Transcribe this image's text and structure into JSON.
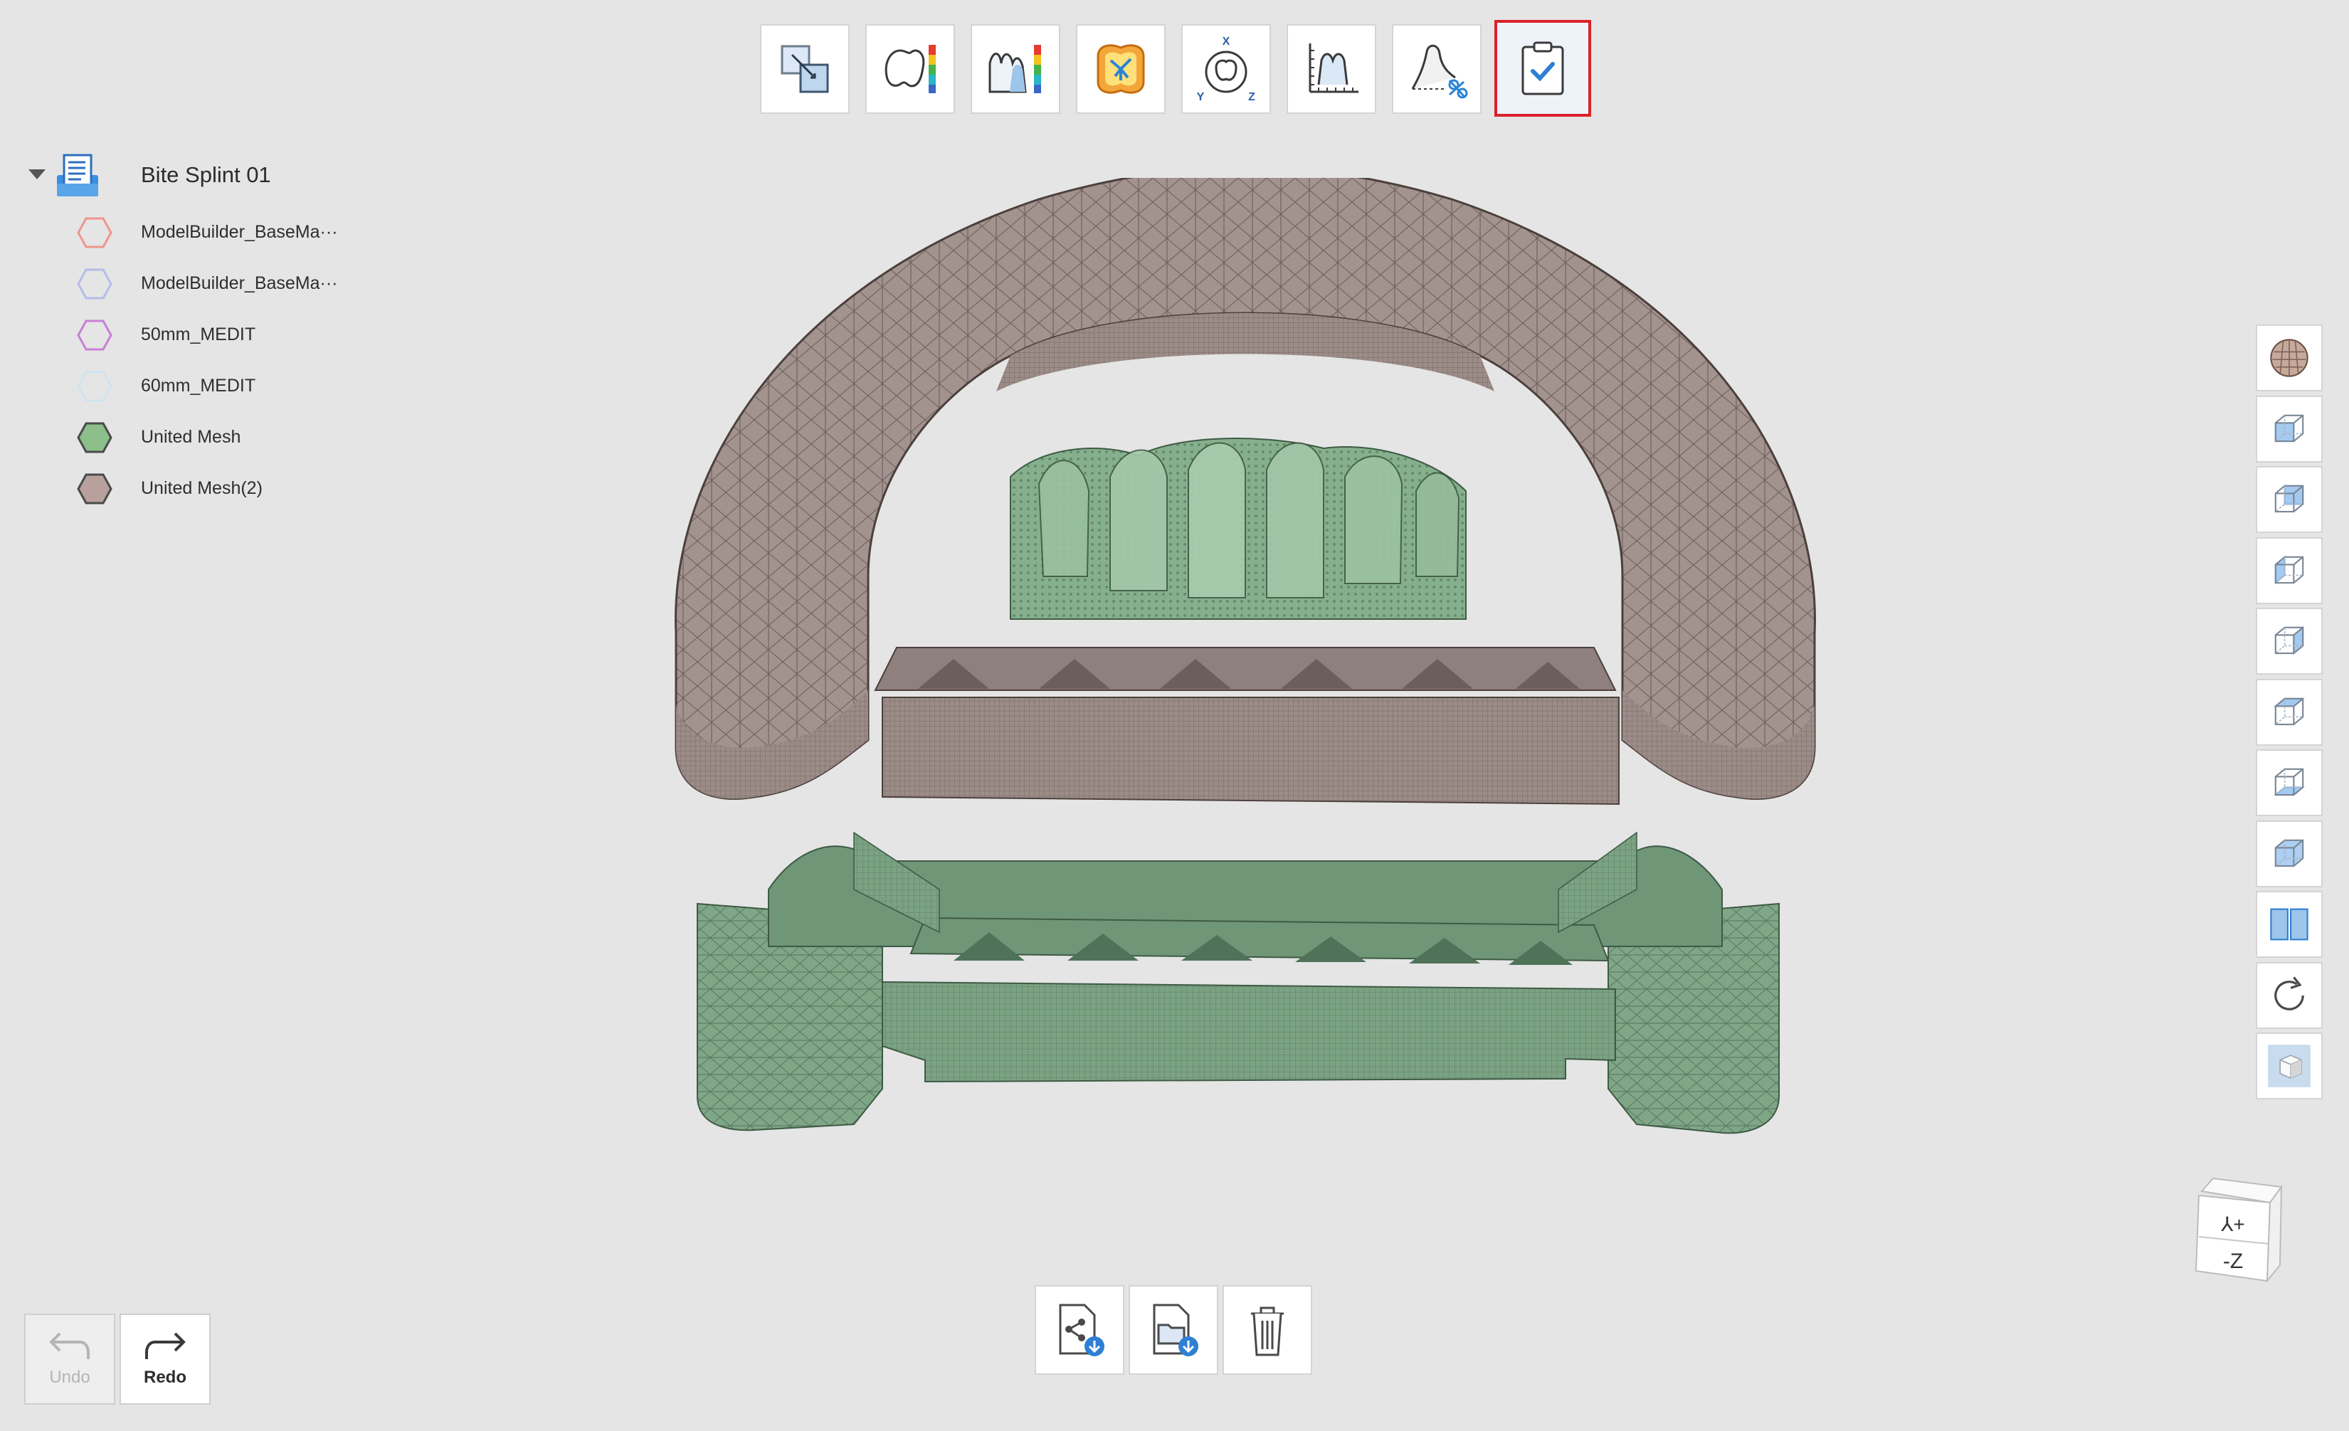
{
  "toolbar": {
    "buttons": [
      {
        "icon": "align-models-icon"
      },
      {
        "icon": "color-deviation-icon"
      },
      {
        "icon": "section-deviation-icon"
      },
      {
        "icon": "occlusion-analysis-icon"
      },
      {
        "icon": "axis-rotation-icon"
      },
      {
        "icon": "measure-icon"
      },
      {
        "icon": "trim-icon"
      },
      {
        "icon": "complete-check-icon",
        "active": true
      }
    ]
  },
  "tree": {
    "root_label": "Bite Splint 01",
    "items": [
      {
        "label": "ModelBuilder_BaseMa···",
        "color": "#f0958f",
        "filled": false
      },
      {
        "label": "ModelBuilder_BaseMa···",
        "color": "#b7bbe8",
        "filled": false
      },
      {
        "label": "50mm_MEDIT",
        "color": "#c77fd6",
        "filled": false
      },
      {
        "label": "60mm_MEDIT",
        "color": "#cfe4ef",
        "filled": false
      },
      {
        "label": "United Mesh",
        "color": "#8dbf8a",
        "filled": true
      },
      {
        "label": "United Mesh(2)",
        "color": "#b8a09c",
        "filled": true
      }
    ]
  },
  "right_toolbar": {
    "buttons": [
      {
        "icon": "mesh-display-icon"
      },
      {
        "icon": "front-view-icon"
      },
      {
        "icon": "back-view-icon"
      },
      {
        "icon": "left-view-icon"
      },
      {
        "icon": "right-view-icon"
      },
      {
        "icon": "top-view-icon"
      },
      {
        "icon": "bottom-view-icon"
      },
      {
        "icon": "default-view-icon"
      },
      {
        "icon": "split-view-icon"
      },
      {
        "icon": "reset-rotation-icon"
      },
      {
        "icon": "solid-box-icon"
      }
    ]
  },
  "nav_cube": {
    "face_top": "⅄+",
    "face_front": "-Z"
  },
  "bottom_toolbar": {
    "buttons": [
      {
        "icon": "export-share-icon"
      },
      {
        "icon": "open-folder-icon"
      },
      {
        "icon": "trash-icon"
      }
    ]
  },
  "history": {
    "undo_label": "Undo",
    "redo_label": "Redo"
  },
  "colors": {
    "splint": "#9f8f8b",
    "model": "#7fa787",
    "active_border": "#d9222a",
    "accent_blue": "#2f7fd4"
  }
}
